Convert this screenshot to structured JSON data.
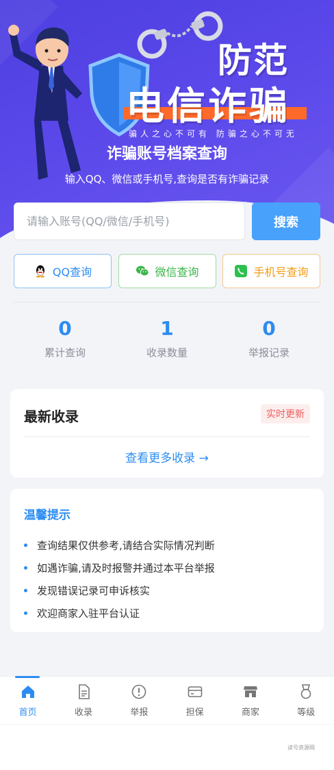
{
  "hero": {
    "title_line1": "防范",
    "title_line2": "电信诈骗",
    "slogan": "骗人之心不可有  防骗之心不可无",
    "heading": "诈骗账号档案查询",
    "subheading": "输入QQ、微信或手机号,查询是否有诈骗记录"
  },
  "search": {
    "placeholder": "请输入账号(QQ/微信/手机号)",
    "value": "",
    "button_label": "搜索"
  },
  "query_types": [
    {
      "label": "QQ查询",
      "icon": "qq-icon",
      "color": "#2d8cf0"
    },
    {
      "label": "微信查询",
      "icon": "wechat-icon",
      "color": "#39b54a"
    },
    {
      "label": "手机号查询",
      "icon": "phone-icon",
      "color": "#f39c12"
    }
  ],
  "stats": [
    {
      "value": "0",
      "label": "累计查询"
    },
    {
      "value": "1",
      "label": "收录数量"
    },
    {
      "value": "0",
      "label": "举报记录"
    }
  ],
  "latest": {
    "title": "最新收录",
    "badge": "实时更新",
    "more_link": "查看更多收录 →"
  },
  "tips": {
    "title": "温馨提示",
    "items": [
      "查询结果仅供参考,请结合实际情况判断",
      "如遇诈骗,请及时报警并通过本平台举报",
      "发现错误记录可申诉核实",
      "欢迎商家入驻平台认证"
    ]
  },
  "tabbar": {
    "active_index": 0,
    "items": [
      {
        "label": "首页",
        "icon": "home-icon"
      },
      {
        "label": "收录",
        "icon": "document-icon"
      },
      {
        "label": "举报",
        "icon": "alert-icon"
      },
      {
        "label": "担保",
        "icon": "card-icon"
      },
      {
        "label": "商家",
        "icon": "store-icon"
      },
      {
        "label": "等级",
        "icon": "medal-icon"
      }
    ]
  },
  "watermark": "读号资源网",
  "colors": {
    "accent": "#2d8cf0",
    "search_button": "#48a1fb",
    "hero_bg": "#5044e4",
    "hero_bar": "#ff6a2b",
    "badge_text": "#ef5d5d"
  }
}
